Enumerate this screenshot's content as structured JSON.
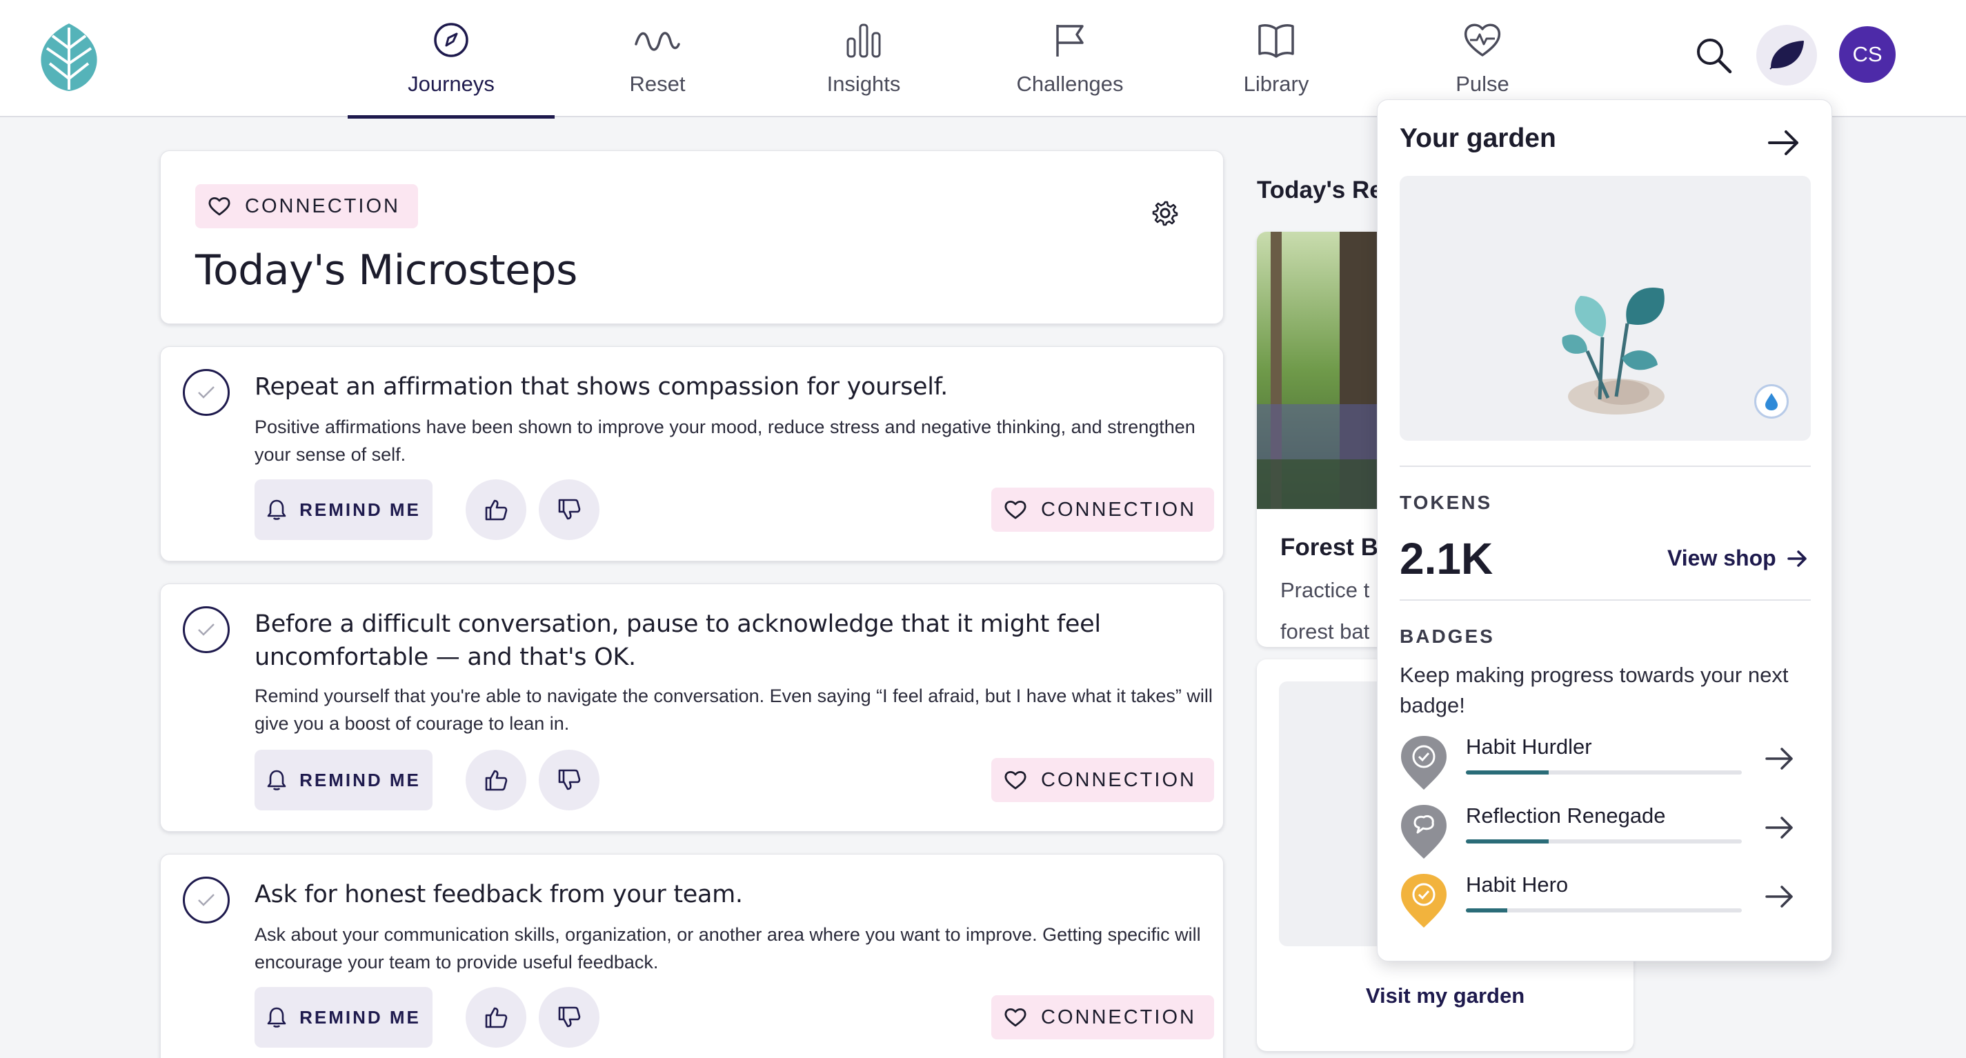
{
  "nav": {
    "items": [
      {
        "label": "Journeys",
        "icon": "compass-icon",
        "active": true
      },
      {
        "label": "Reset",
        "icon": "wave-icon"
      },
      {
        "label": "Insights",
        "icon": "bar-chart-icon"
      },
      {
        "label": "Challenges",
        "icon": "flag-icon"
      },
      {
        "label": "Library",
        "icon": "book-icon"
      },
      {
        "label": "Pulse",
        "icon": "heart-pulse-icon"
      }
    ],
    "avatar_initials": "CS"
  },
  "colors": {
    "primary": "#1e1a4d",
    "tag_bg": "#fbe6f1",
    "avatar": "#4d2aa8",
    "progress": "#2a6c78"
  },
  "main": {
    "tag": "CONNECTION",
    "title": "Today's Microsteps",
    "steps": [
      {
        "title": "Repeat an affirmation that shows compassion for yourself.",
        "body": "Positive affirmations have been shown to improve your mood, reduce stress and negative thinking, and strengthen your sense of self.",
        "remind": "REMIND ME",
        "tag": "CONNECTION"
      },
      {
        "title": "Before a difficult conversation, pause to acknowledge that it might feel uncomfortable — and that's OK.",
        "body": "Remind yourself that you're able to navigate the conversation. Even saying “I feel afraid, but I have what it takes” will give you a boost of courage to lean in.",
        "remind": "REMIND ME",
        "tag": "CONNECTION"
      },
      {
        "title": "Ask for honest feedback from your team.",
        "body": "Ask about your communication skills, organization, or another area where you want to improve. Getting specific will encourage your team to provide useful feedback.",
        "remind": "REMIND ME",
        "tag": "CONNECTION"
      }
    ]
  },
  "middle": {
    "title": "Today's Re",
    "forest_title": "Forest B",
    "forest_desc_1": "Practice t",
    "forest_desc_2": "forest bat",
    "visit_garden": "Visit my garden"
  },
  "popover": {
    "title": "Your garden",
    "tokens_label": "TOKENS",
    "tokens_value": "2.1K",
    "view_shop": "View shop",
    "badges_label": "BADGES",
    "badges_desc": "Keep making progress towards your next badge!",
    "badges": [
      {
        "name": "Habit Hurdler",
        "progress": 0.3
      },
      {
        "name": "Reflection Renegade",
        "progress": 0.3
      },
      {
        "name": "Habit Hero",
        "progress": 0.15
      }
    ]
  }
}
